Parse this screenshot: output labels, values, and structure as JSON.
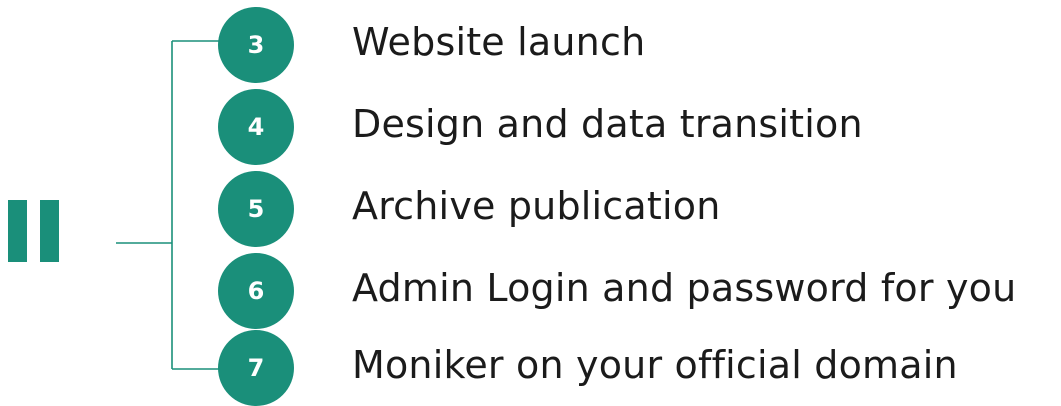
{
  "section": {
    "numeral": "II",
    "accent_color": "#1a8f7a",
    "text_color": "#1b1b1b"
  },
  "items": [
    {
      "number": "3",
      "label": "Website launch"
    },
    {
      "number": "4",
      "label": "Design and data transition"
    },
    {
      "number": "5",
      "label": "Archive publication"
    },
    {
      "number": "6",
      "label": "Admin Login and password for you"
    },
    {
      "number": "7",
      "label": "Moniker on your official domain"
    }
  ]
}
